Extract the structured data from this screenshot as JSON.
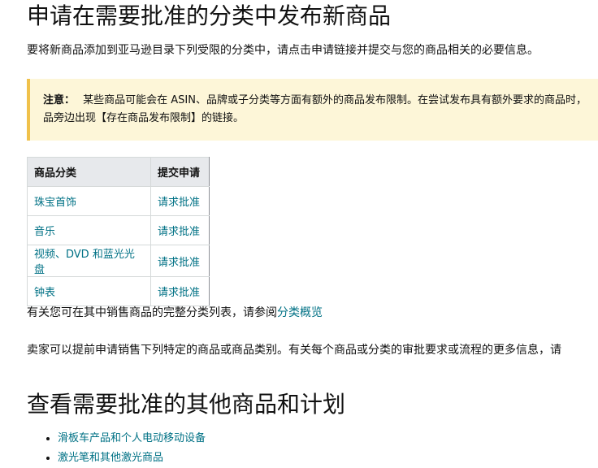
{
  "heading": "申请在需要批准的分类中发布新商品",
  "intro": "要将新商品添加到亚马逊目录下列受限的分类中，请点击申请链接并提交与您的商品相关的必要信息。",
  "note": {
    "label": "注意：",
    "line1": "某些商品可能会在 ASIN、品牌或子分类等方面有额外的商品发布限制。在尝试发布具有额外要求的商品时，",
    "line2": "品旁边出现【存在商品发布限制】的链接。"
  },
  "table": {
    "headers": [
      "商品分类",
      "提交申请"
    ],
    "rows": [
      {
        "category": "珠宝首饰",
        "action": "请求批准"
      },
      {
        "category": "音乐",
        "action": "请求批准"
      },
      {
        "category": "视频、DVD 和蓝光光盘",
        "action": "请求批准"
      },
      {
        "category": "钟表",
        "action": "请求批准"
      }
    ]
  },
  "overview": {
    "prefix": "有关您可在其中销售商品的完整分类列表，请参阅",
    "link": "分类概览"
  },
  "sellers_text": "卖家可以提前申请销售下列特定的商品或商品类别。有关每个商品或分类的审批要求或流程的更多信息，请",
  "heading2": "查看需要批准的其他商品和计划",
  "list": [
    "滑板车产品和个人电动移动设备",
    "激光笔和其他激光商品"
  ],
  "colors": {
    "link": "#007185",
    "note_bg": "#fdf6d8",
    "note_border": "#f0c14b",
    "table_header_bg": "#e7e9ec"
  }
}
